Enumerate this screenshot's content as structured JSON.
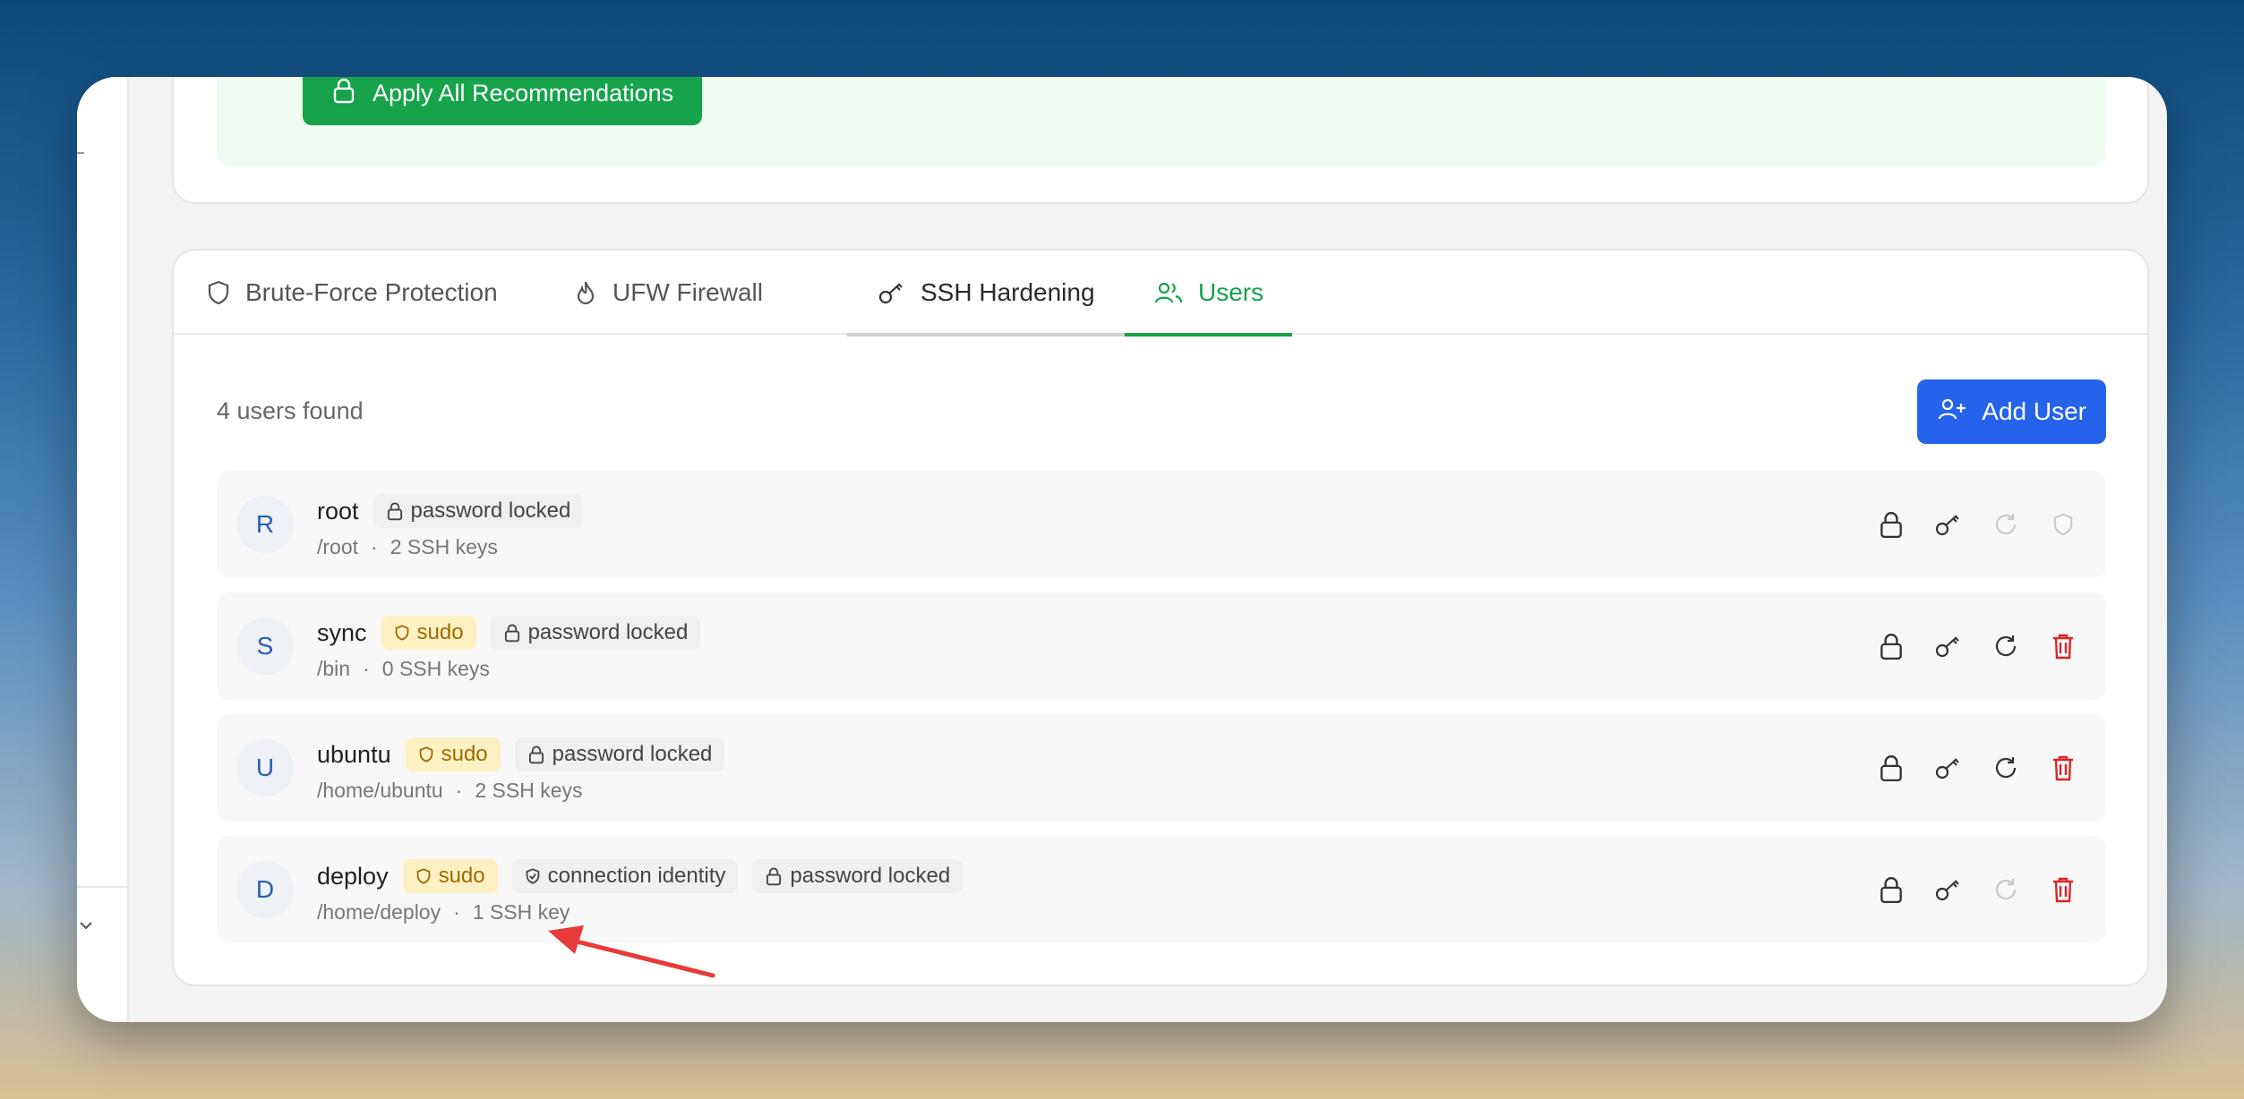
{
  "top": {
    "apply_label": "Apply All Recommendations"
  },
  "tabs": [
    {
      "label": "Brute-Force Protection",
      "icon": "shield-icon"
    },
    {
      "label": "UFW Firewall",
      "icon": "flame-icon"
    },
    {
      "label": "SSH Hardening",
      "icon": "key-icon"
    },
    {
      "label": "Users",
      "icon": "users-icon"
    }
  ],
  "users_panel": {
    "count_label": "4 users found",
    "add_label": "Add User",
    "sep": "·",
    "users": [
      {
        "initial": "R",
        "name": "root",
        "badges": [
          "password locked"
        ],
        "home": "/root",
        "keys": "2 SSH keys"
      },
      {
        "initial": "S",
        "name": "sync",
        "sudo": "sudo",
        "badges": [
          "password locked"
        ],
        "home": "/bin",
        "keys": "0 SSH keys"
      },
      {
        "initial": "U",
        "name": "ubuntu",
        "sudo": "sudo",
        "badges": [
          "password locked"
        ],
        "home": "/home/ubuntu",
        "keys": "2 SSH keys"
      },
      {
        "initial": "D",
        "name": "deploy",
        "sudo": "sudo",
        "identity": "connection identity",
        "badges": [
          "password locked"
        ],
        "home": "/home/deploy",
        "keys": "1 SSH key"
      }
    ]
  },
  "colors": {
    "green": "#16a34a",
    "blue": "#2563eb",
    "red": "#dc2626",
    "sudo_bg": "#fdf1c3"
  }
}
